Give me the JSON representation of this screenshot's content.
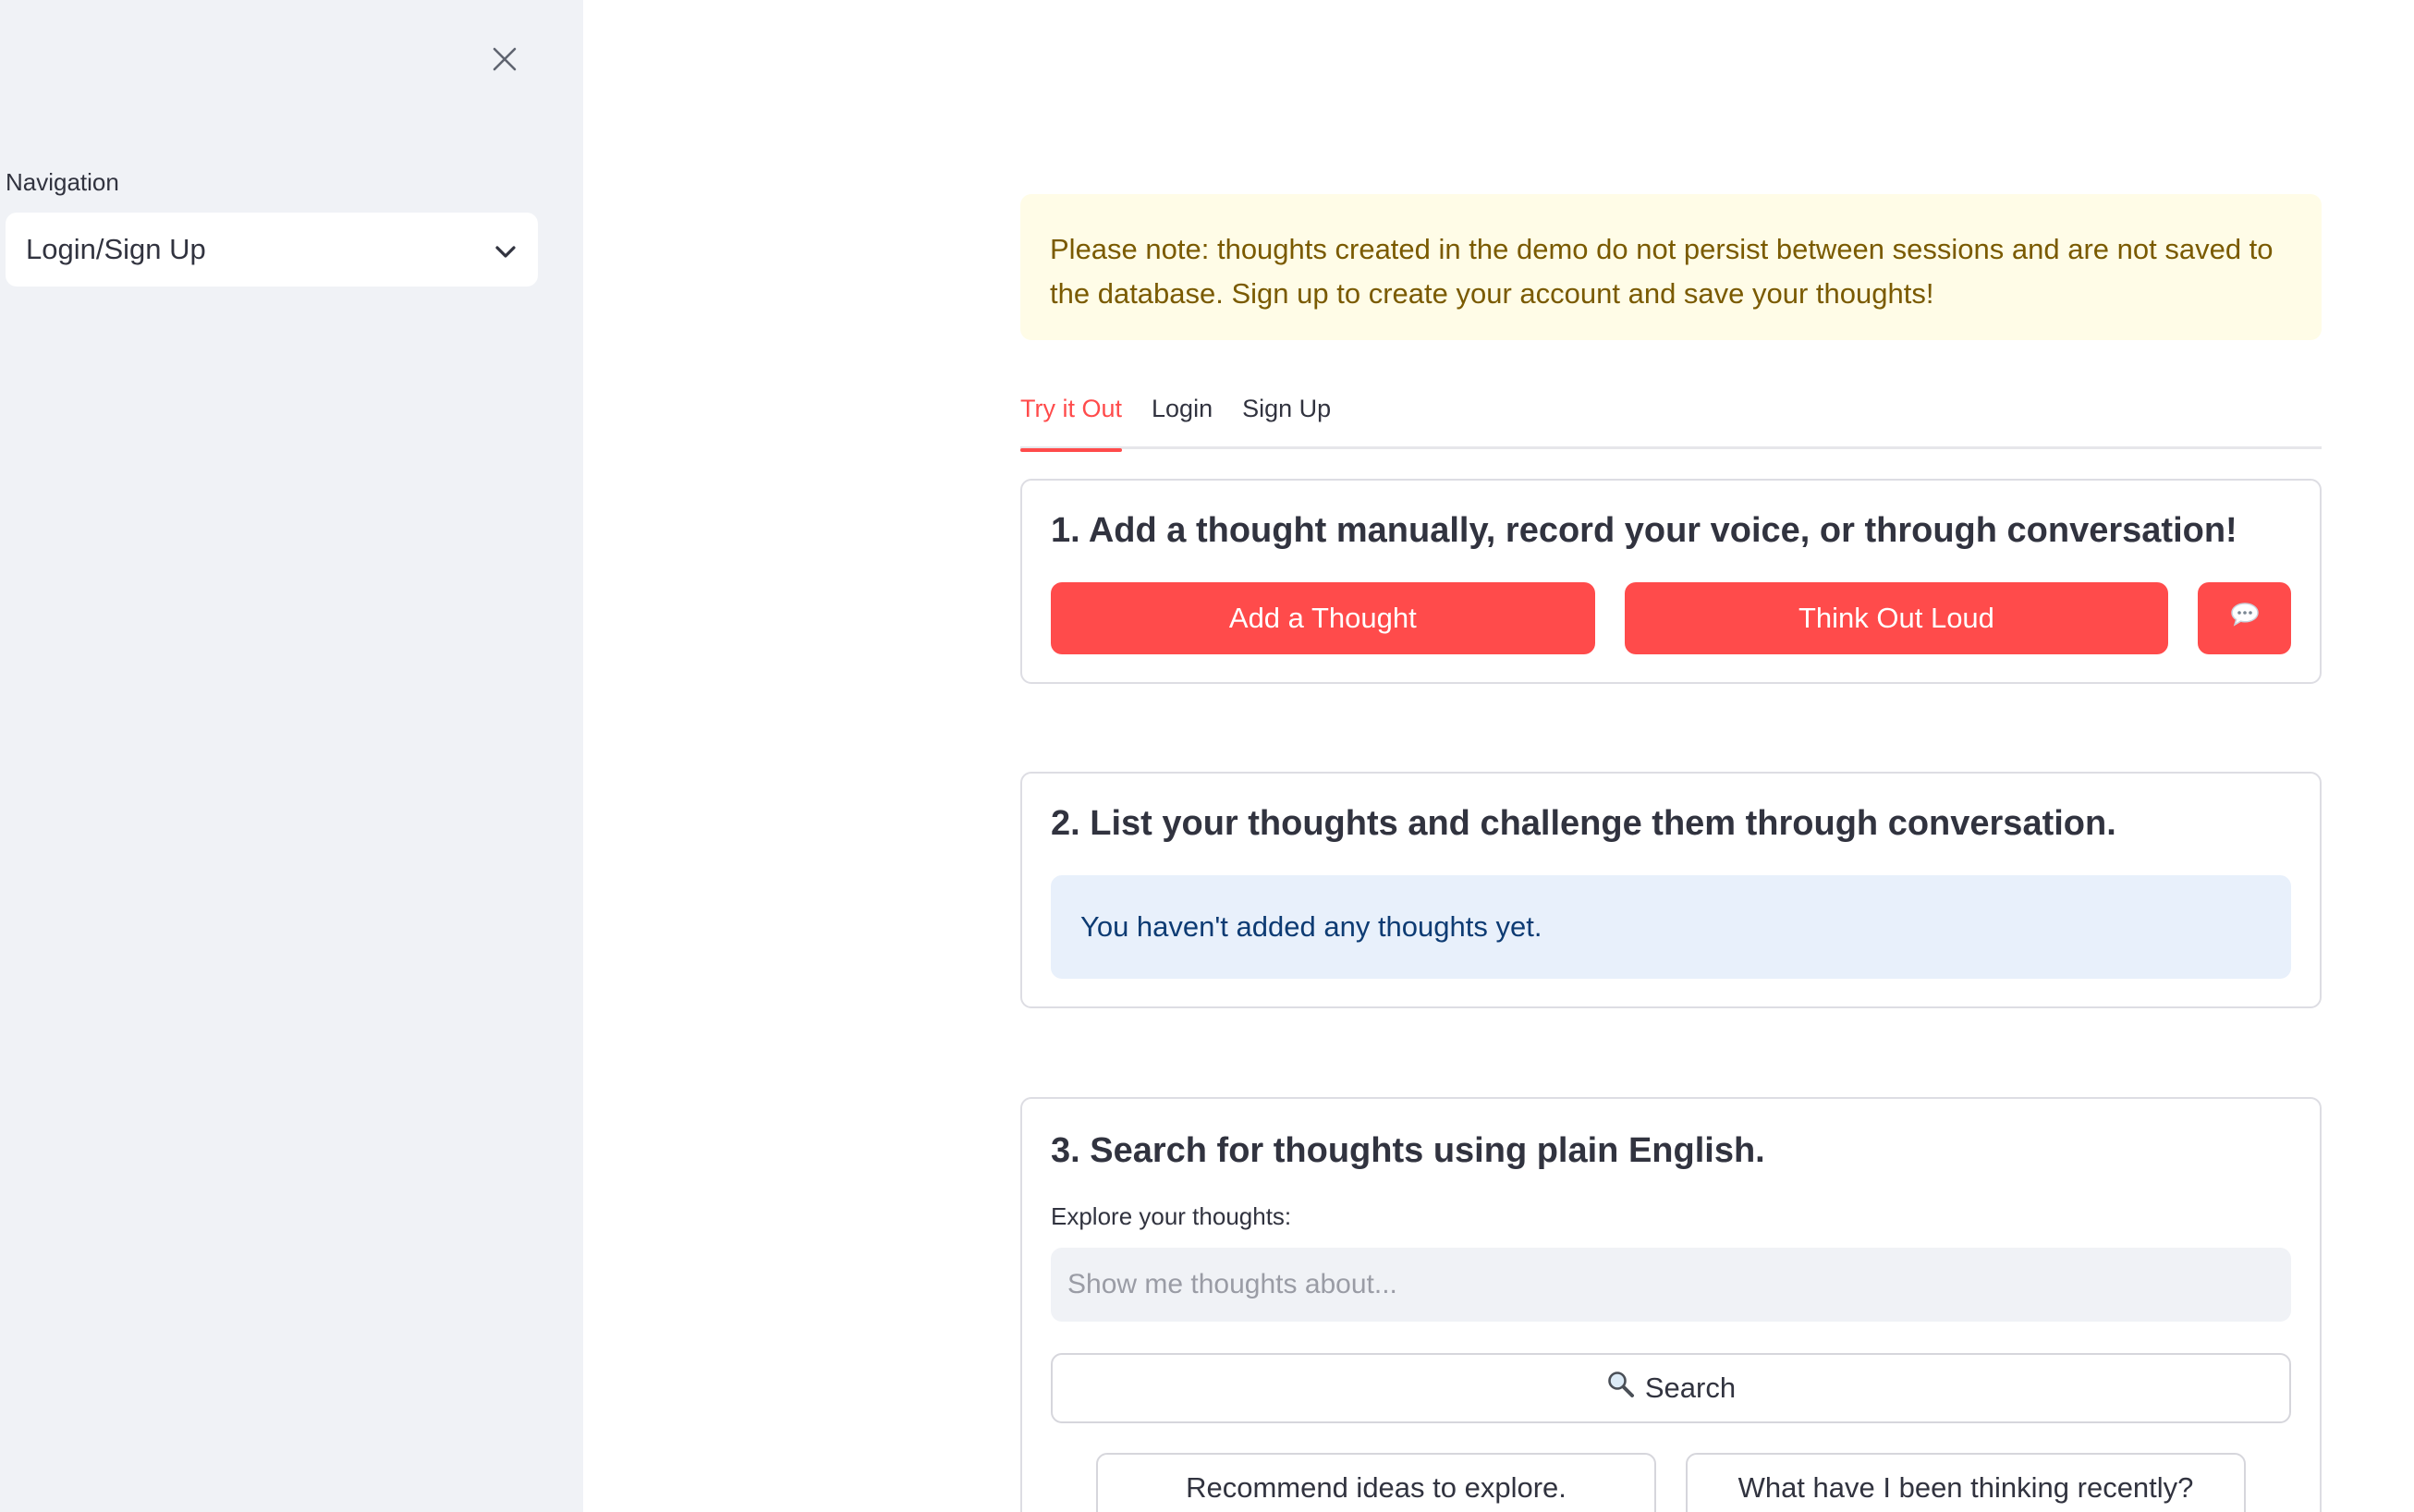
{
  "sidebar": {
    "nav_label": "Navigation",
    "nav_selected": "Login/Sign Up",
    "close_icon": "close-icon",
    "chevron_icon": "chevron-down-icon"
  },
  "notice": {
    "text": "Please note: thoughts created in the demo do not persist between sessions and are not saved to the database. Sign up to create your account and save your thoughts!"
  },
  "tabs": [
    {
      "label": "Try it Out",
      "active": true
    },
    {
      "label": "Login",
      "active": false
    },
    {
      "label": "Sign Up",
      "active": false
    }
  ],
  "section1": {
    "title": "1. Add a thought manually, record your voice, or through conversation!",
    "add_button": "Add a Thought",
    "voice_button": "Think Out Loud",
    "chat_icon": "speech-bubble-icon"
  },
  "section2": {
    "title": "2. List your thoughts and challenge them through conversation.",
    "empty_message": "You haven't added any thoughts yet."
  },
  "section3": {
    "title": "3. Search for thoughts using plain English.",
    "field_label": "Explore your thoughts:",
    "placeholder": "Show me thoughts about...",
    "search_button": "Search",
    "search_icon": "magnifier-icon",
    "suggestions": [
      "Recommend ideas to explore.",
      "What have I been thinking recently?"
    ]
  },
  "colors": {
    "accent": "#ff4b4b",
    "sidebar_bg": "#f0f2f6",
    "notice_bg": "#fffce7",
    "info_bg": "#e8f0fb"
  }
}
